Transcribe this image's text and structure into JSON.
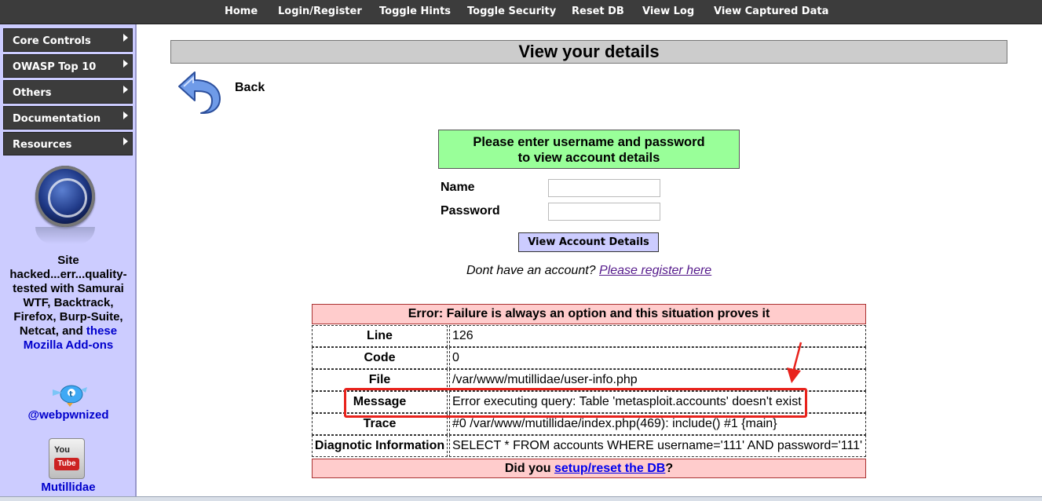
{
  "nav": {
    "items": [
      "Home",
      "Login/Register",
      "Toggle Hints",
      "Toggle Security",
      "Reset DB",
      "View Log",
      "View Captured Data"
    ]
  },
  "sidebar": {
    "menu": [
      "Core Controls",
      "OWASP Top 10",
      "Others",
      "Documentation",
      "Resources"
    ],
    "site_text": {
      "line1": "Site",
      "line2": "hacked...err...quality-",
      "line3": "tested with Samurai",
      "line4": "WTF, Backtrack,",
      "line5": "Firefox, Burp-Suite,",
      "line6_pre": "Netcat, and",
      "line6_link": "these",
      "line7": "Mozilla Add-ons"
    },
    "twitter_label": "@webpwnized",
    "youtube": {
      "you": "You",
      "tube": "Tube",
      "label": "Mutillidae"
    }
  },
  "main": {
    "title": "View your details",
    "back_label": "Back",
    "prompt_line1": "Please enter username and password",
    "prompt_line2": "to view account details",
    "name_label": "Name",
    "password_label": "Password",
    "name_value": "",
    "password_value": "",
    "submit_label": "View Account Details",
    "register_prefix": "Dont have an account?",
    "register_link": "Please register here"
  },
  "error": {
    "header": "Error: Failure is always an option and this situation proves it",
    "rows": [
      {
        "key": "Line",
        "value": "126"
      },
      {
        "key": "Code",
        "value": "0"
      },
      {
        "key": "File",
        "value": "/var/www/mutillidae/user-info.php"
      },
      {
        "key": "Message",
        "value": "Error executing query: Table 'metasploit.accounts' doesn't exist"
      },
      {
        "key": "Trace",
        "value": "#0 /var/www/mutillidae/index.php(469): include() #1 {main}"
      },
      {
        "key": "Diagnotic Information",
        "value": "SELECT * FROM accounts WHERE username='111' AND password='111'"
      }
    ],
    "footer_prefix": "Did you",
    "footer_link": "setup/reset the DB",
    "footer_suffix": "?"
  },
  "colors": {
    "nav_bg": "#3c3c3c",
    "sidebar_bg": "#ccccff",
    "prompt_bg": "#99ff99",
    "error_bg": "#ffcccc",
    "highlight": "#e8221c"
  }
}
